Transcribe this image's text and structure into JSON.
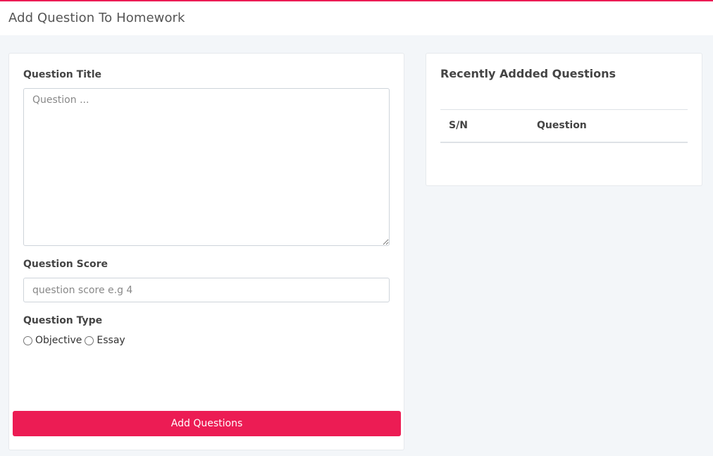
{
  "header": {
    "title": "Add Question To Homework",
    "accent_color": "#ec1c54"
  },
  "form": {
    "question_title_label": "Question Title",
    "question_title_placeholder": "Question ...",
    "question_score_label": "Question Score",
    "question_score_placeholder": "question score e.g 4",
    "question_type_label": "Question Type",
    "question_types": [
      {
        "label": "Objective",
        "selected": false
      },
      {
        "label": "Essay",
        "selected": false
      }
    ],
    "submit_label": "Add Questions"
  },
  "recent": {
    "title": "Recently Addded Questions",
    "columns": [
      "S/N",
      "Question"
    ],
    "rows": []
  }
}
